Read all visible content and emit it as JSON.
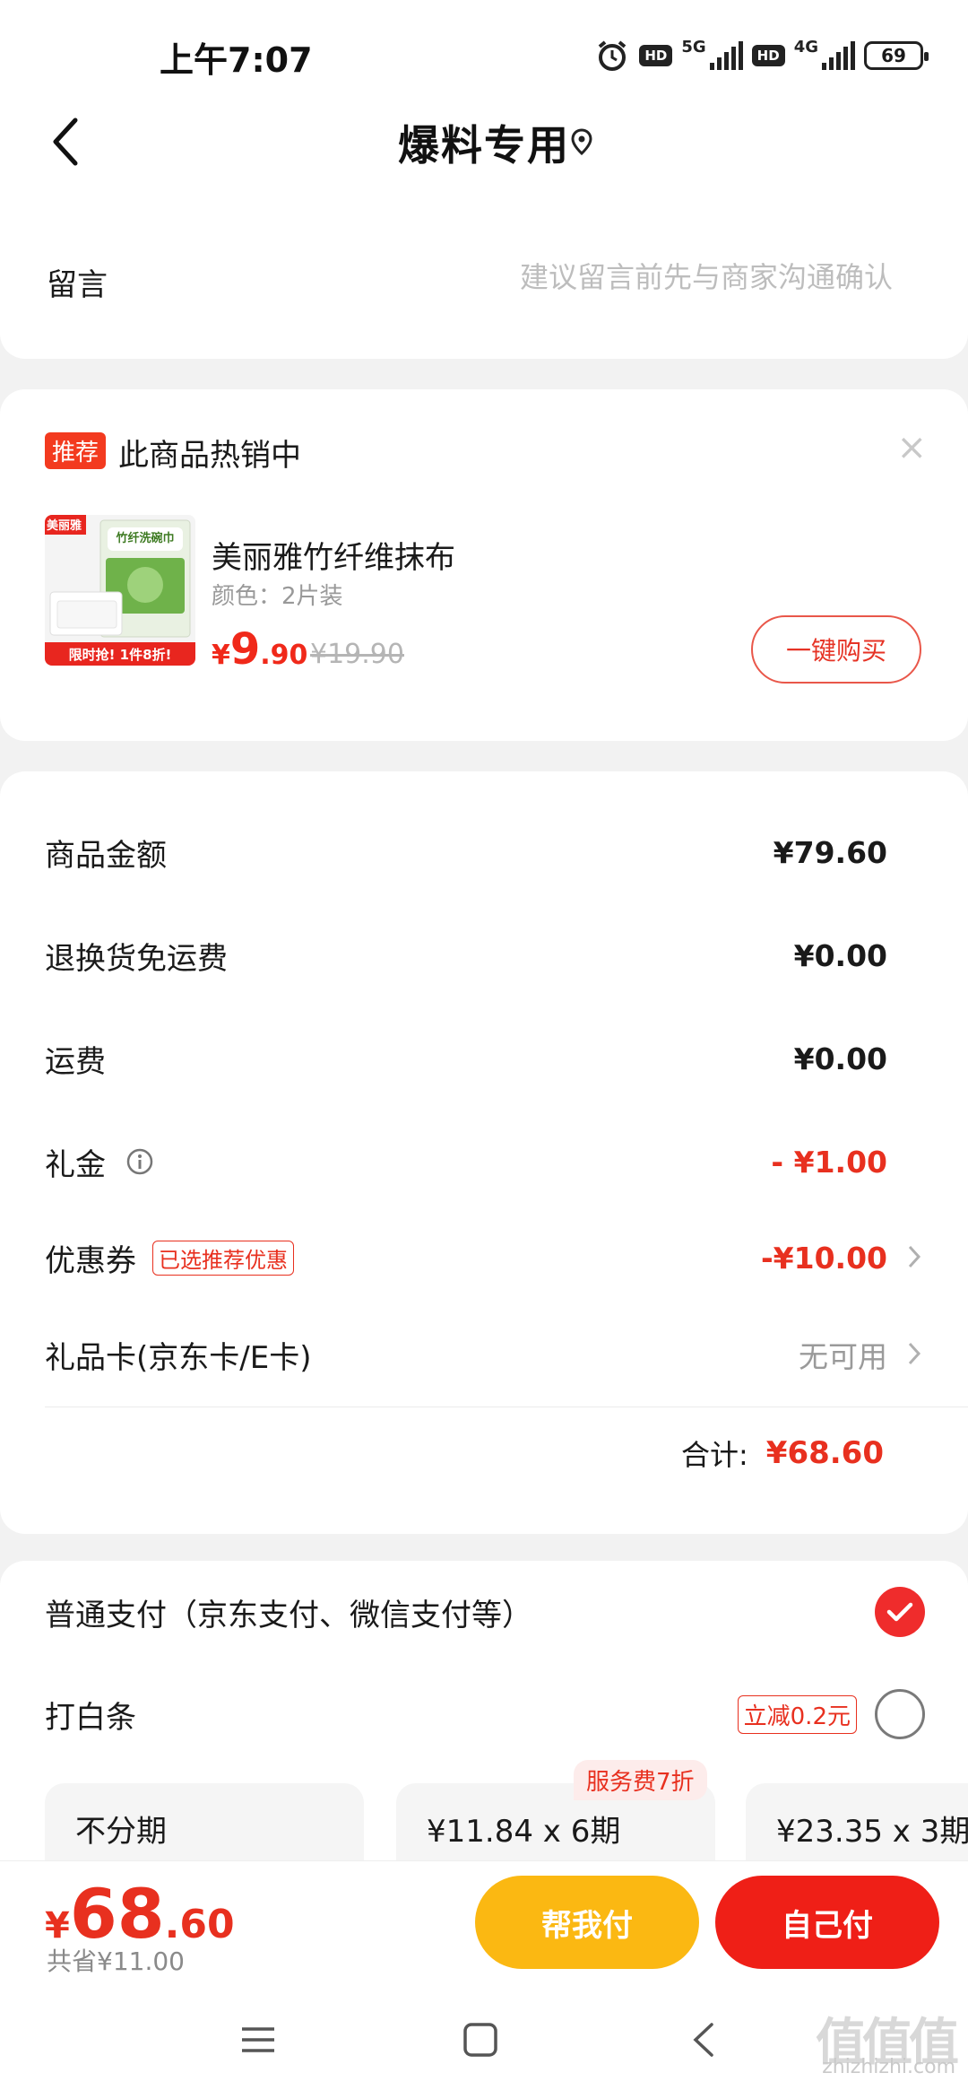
{
  "status_bar": {
    "time": "上午7:07",
    "hd1": "HD",
    "net1": "5G",
    "hd2": "HD",
    "net2": "4G",
    "battery": "69"
  },
  "header": {
    "title": "爆料专用"
  },
  "message": {
    "label": "留言",
    "placeholder": "建议留言前先与商家沟通确认"
  },
  "recommend": {
    "tag": "推荐",
    "title": "此商品热销中",
    "close": "×",
    "product": {
      "brand_badge": "美丽雅",
      "pack_label": "竹纤洗碗巾",
      "promo_banner": "限时抢! 1件8折!",
      "name": "美丽雅竹纤维抹布",
      "spec": "颜色：2片装",
      "price_currency": "¥",
      "price_int": "9",
      "price_dec": ".90",
      "original_price": "¥19.90"
    },
    "buy_label": "一键购买"
  },
  "amounts": {
    "goods": {
      "label": "商品金额",
      "value": "¥79.60"
    },
    "return_shipping": {
      "label": "退换货免运费",
      "value": "¥0.00"
    },
    "shipping": {
      "label": "运费",
      "value": "¥0.00"
    },
    "gift_money": {
      "label": "礼金",
      "value": "- ¥1.00"
    },
    "coupon": {
      "label": "优惠券",
      "tag": "已选推荐优惠",
      "value": "-¥10.00"
    },
    "gift_card": {
      "label": "礼品卡(京东卡/E卡)",
      "value": "无可用"
    },
    "total": {
      "label": "合计:",
      "value": "¥68.60"
    }
  },
  "payment": {
    "normal": {
      "label": "普通支付（京东支付、微信支付等）",
      "selected": true
    },
    "baitiao": {
      "label": "打白条",
      "discount": "立减0.2元",
      "selected": false
    },
    "plan_badge": "服务费7折",
    "plans": [
      {
        "label": "不分期"
      },
      {
        "label": "¥11.84 x 6期"
      },
      {
        "label": "¥23.35 x 3期"
      }
    ]
  },
  "bottom_bar": {
    "price_currency": "¥",
    "price_int": "68",
    "price_dec": ".60",
    "savings": "共省¥11.00",
    "help_pay": "帮我付",
    "self_pay": "自己付"
  },
  "watermark": {
    "logo": "值值值",
    "url": "zhizhizhi.com"
  },
  "colors": {
    "accent_red": "#e8301f",
    "help_button": "#fbb812",
    "self_button": "#ef1f17"
  }
}
